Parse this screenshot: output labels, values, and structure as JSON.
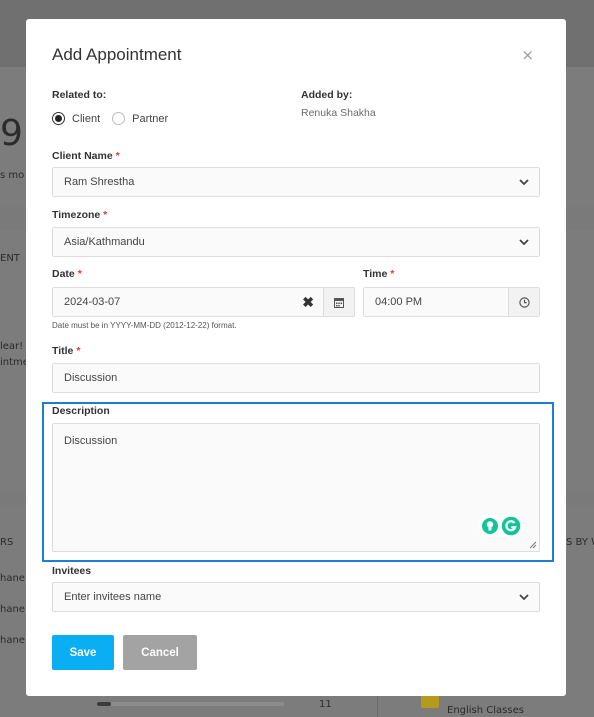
{
  "background": {
    "big_digit": "9",
    "text_s_mo": "s mo",
    "text_ent": "ENT",
    "text_clear": "lear!",
    "text_intme": "intme",
    "text_rs": "RS",
    "text_hane_1": "hane",
    "text_hane_2": "hane",
    "text_hane_3": "hane",
    "text_s_by_w": "S BY W",
    "count_11": "11",
    "english_classes": "English Classes"
  },
  "modal": {
    "title": "Add Appointment",
    "close_symbol": "×",
    "related_to_label": "Related to:",
    "added_by_label": "Added by:",
    "added_by_value": "Renuka Shakha",
    "related_options": [
      {
        "label": "Client",
        "checked": true
      },
      {
        "label": "Partner",
        "checked": false
      }
    ],
    "client_name": {
      "label": "Client Name",
      "required_mark": "*",
      "value": "Ram Shrestha"
    },
    "timezone": {
      "label": "Timezone",
      "required_mark": "*",
      "value": "Asia/Kathmandu"
    },
    "date": {
      "label": "Date",
      "required_mark": "*",
      "value": "2024-03-07",
      "hint": "Date must be in YYYY-MM-DD (2012-12-22) format."
    },
    "time": {
      "label": "Time",
      "required_mark": "*",
      "value": "04:00 PM"
    },
    "title_field": {
      "label": "Title",
      "required_mark": "*",
      "value": "Discussion"
    },
    "description": {
      "label": "Description",
      "value": "Discussion"
    },
    "invitees": {
      "label": "Invitees",
      "placeholder": "Enter invitees name"
    },
    "save_label": "Save",
    "cancel_label": "Cancel"
  },
  "colors": {
    "accent": "#0aaef2",
    "required": "#e53935",
    "highlight": "#1a7fd4",
    "grammarly_green": "#15c39a"
  }
}
